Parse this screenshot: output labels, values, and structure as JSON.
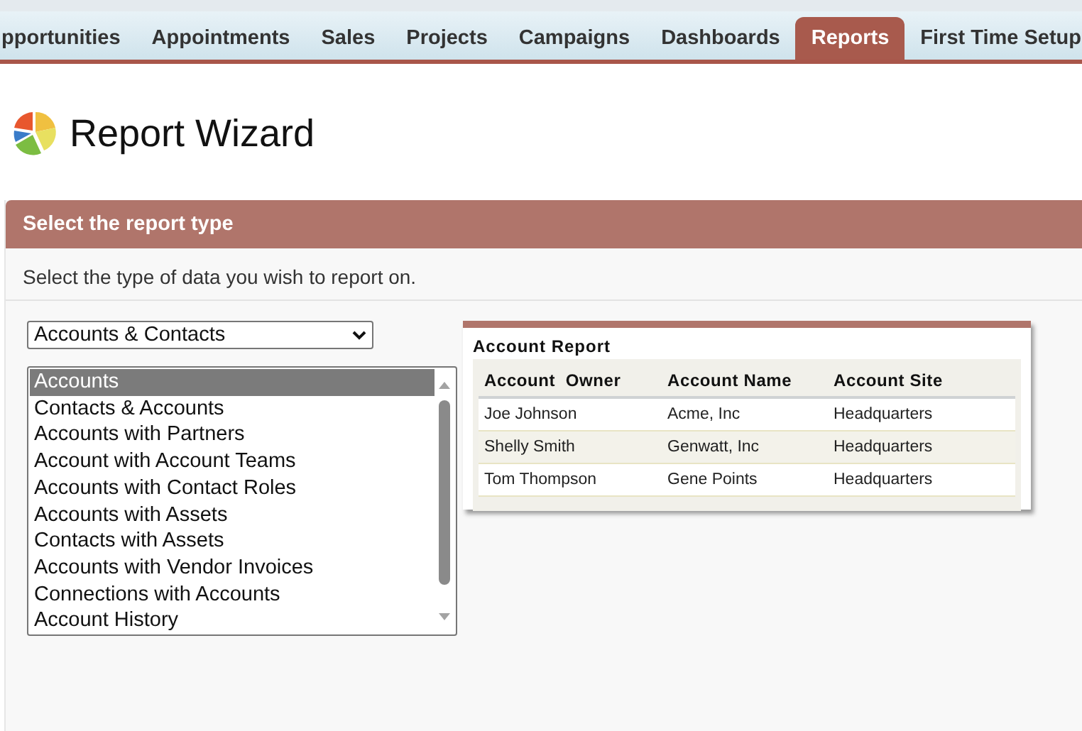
{
  "tabs": [
    {
      "label": "pportunities",
      "selected": false
    },
    {
      "label": "Appointments",
      "selected": false
    },
    {
      "label": "Sales",
      "selected": false
    },
    {
      "label": "Projects",
      "selected": false
    },
    {
      "label": "Campaigns",
      "selected": false
    },
    {
      "label": "Dashboards",
      "selected": false
    },
    {
      "label": "Reports",
      "selected": true
    },
    {
      "label": "First Time Setup",
      "selected": false
    }
  ],
  "page_title": "Report Wizard",
  "section": {
    "title": "Select the report type",
    "instruction": "Select the type of data you wish to report on."
  },
  "category_select": {
    "value": "Accounts & Contacts"
  },
  "report_types": [
    {
      "label": "Accounts",
      "selected": true
    },
    {
      "label": "Contacts & Accounts",
      "selected": false
    },
    {
      "label": "Accounts with Partners",
      "selected": false
    },
    {
      "label": "Account with Account Teams",
      "selected": false
    },
    {
      "label": "Accounts with Contact Roles",
      "selected": false
    },
    {
      "label": "Accounts with Assets",
      "selected": false
    },
    {
      "label": "Contacts with Assets",
      "selected": false
    },
    {
      "label": "Accounts with Vendor Invoices",
      "selected": false
    },
    {
      "label": "Connections with Accounts",
      "selected": false
    },
    {
      "label": "Account History",
      "selected": false
    }
  ],
  "preview": {
    "title": "Account Report",
    "columns": [
      "Account  Owner",
      "Account Name",
      "Account Site"
    ],
    "rows": [
      [
        "Joe Johnson",
        "Acme, Inc",
        "Headquarters"
      ],
      [
        "Shelly Smith",
        "Genwatt, Inc",
        "Headquarters"
      ],
      [
        "Tom Thompson",
        "Gene Points",
        "Headquarters"
      ]
    ]
  }
}
